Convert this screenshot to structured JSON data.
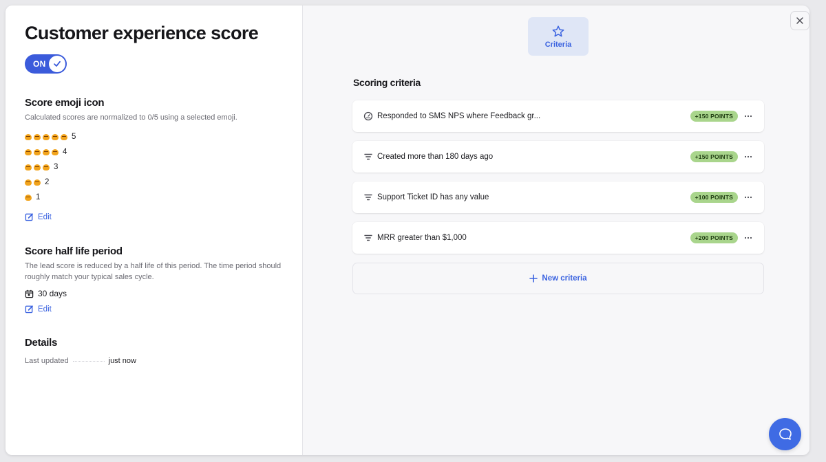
{
  "header": {
    "title": "Customer experience score",
    "toggle_label": "ON"
  },
  "emoji_section": {
    "heading": "Score emoji icon",
    "description": "Calculated scores are normalized to 0/5 using a selected emoji.",
    "icon": "hugging-face-emoji",
    "rows": [
      {
        "count": 5,
        "label": "5"
      },
      {
        "count": 4,
        "label": "4"
      },
      {
        "count": 3,
        "label": "3"
      },
      {
        "count": 2,
        "label": "2"
      },
      {
        "count": 1,
        "label": "1"
      }
    ],
    "edit_label": "Edit"
  },
  "half_life": {
    "heading": "Score half life period",
    "description": "The lead score is reduced by a half life of this period. The time period should roughly match your typical sales cycle.",
    "value": "30 days",
    "edit_label": "Edit"
  },
  "details": {
    "heading": "Details",
    "last_updated_label": "Last updated",
    "last_updated_value": "just now"
  },
  "tabs": {
    "criteria_label": "Criteria"
  },
  "scoring": {
    "heading": "Scoring criteria",
    "items": [
      {
        "icon": "gauge-icon",
        "text": "Responded to SMS NPS where Feedback gr...",
        "points": "+150 POINTS"
      },
      {
        "icon": "filter-icon",
        "text": "Created more than 180 days ago",
        "points": "+150 POINTS"
      },
      {
        "icon": "filter-icon",
        "text": "Support Ticket ID has any value",
        "points": "+100 POINTS"
      },
      {
        "icon": "filter-icon",
        "text": "MRR greater than $1,000",
        "points": "+200 POINTS"
      }
    ],
    "new_label": "New criteria"
  },
  "colors": {
    "accent": "#3b63e0",
    "badge": "#a9d58c",
    "emoji": "#f2a41c"
  }
}
